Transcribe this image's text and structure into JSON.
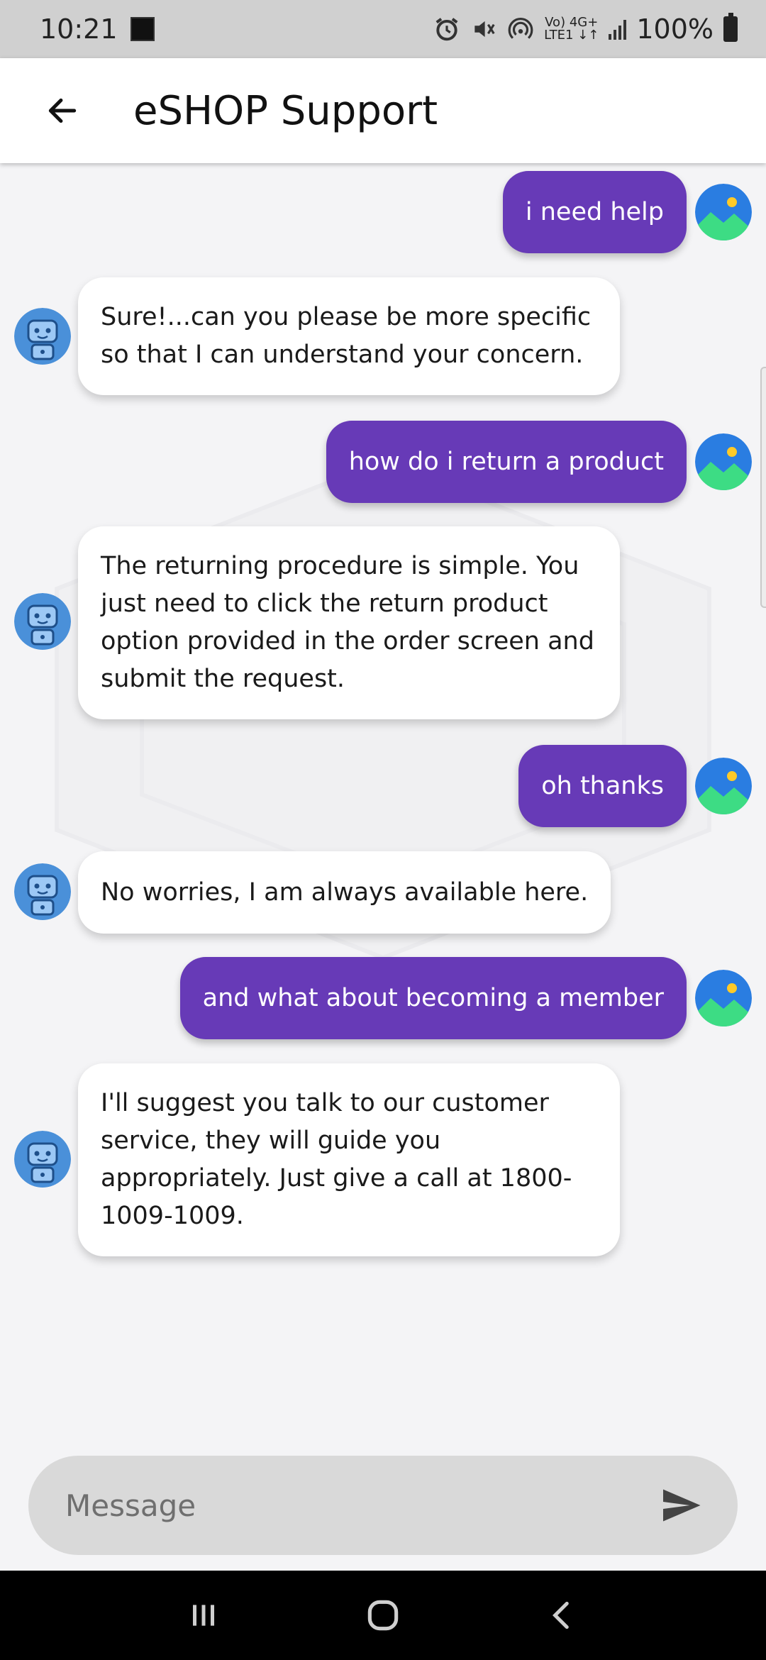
{
  "status_bar": {
    "time": "10:21",
    "network_top": "Vo) 4G+",
    "network_bottom": "LTE1 ↓↑",
    "battery": "100%"
  },
  "app_bar": {
    "title": "eSHOP Support"
  },
  "messages": [
    {
      "sender": "user",
      "text": "i need help"
    },
    {
      "sender": "bot",
      "text": "Sure!...can you please be more specific so that I can understand your concern."
    },
    {
      "sender": "user",
      "text": "how do i return a product"
    },
    {
      "sender": "bot",
      "text": "The returning procedure is simple. You just need to click the return product option provided in the order screen and submit the request."
    },
    {
      "sender": "user",
      "text": "oh thanks"
    },
    {
      "sender": "bot",
      "text": "No worries, I am always available here."
    },
    {
      "sender": "user",
      "text": "and what about becoming a member"
    },
    {
      "sender": "bot",
      "text": "I'll suggest you talk to our customer service, they will guide you appropriately. Just give a call at 1800-1009-1009."
    }
  ],
  "composer": {
    "placeholder": "Message"
  },
  "colors": {
    "user_bubble": "#673ab7",
    "bot_bubble": "#ffffff",
    "app_bar": "#ffffff",
    "status_bar": "#d0d0d0",
    "composer": "#d9d9d9"
  },
  "icons": {
    "back": "arrow-left-icon",
    "user_avatar": "image-placeholder-icon",
    "bot_avatar": "robot-icon",
    "send": "send-icon"
  }
}
